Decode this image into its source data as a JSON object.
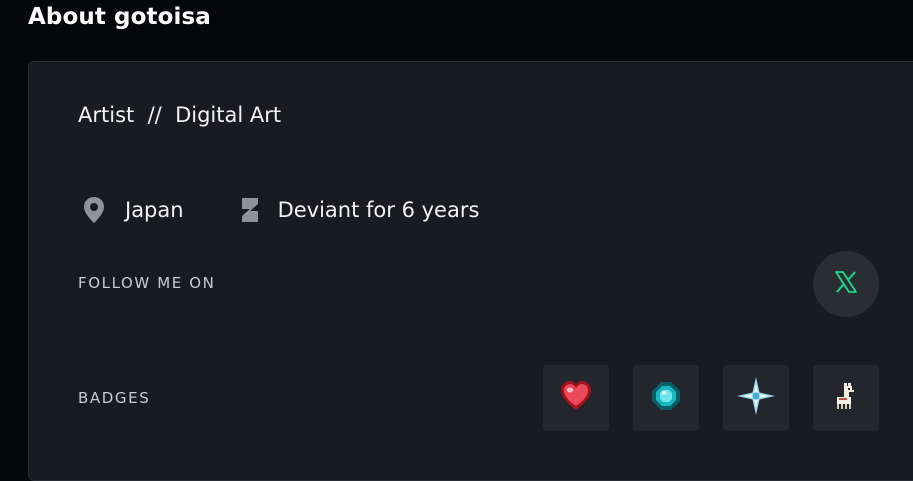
{
  "section": {
    "title": "About gotoisa"
  },
  "profile": {
    "tagline": "Artist  //  Digital Art",
    "location": "Japan",
    "deviant_since": "Deviant for 6 years"
  },
  "follow": {
    "label": "FOLLOW ME ON",
    "links": [
      {
        "icon": "x-twitter-icon",
        "color": "#1ed98b"
      }
    ]
  },
  "badges": {
    "label": "BADGES",
    "items": [
      {
        "icon": "heart-badge-icon"
      },
      {
        "icon": "gem-badge-icon"
      },
      {
        "icon": "sparkle-badge-icon"
      },
      {
        "icon": "llama-badge-icon"
      }
    ]
  },
  "colors": {
    "background": "#06070b",
    "card": "#191b20",
    "accent_green": "#1ed98b"
  }
}
